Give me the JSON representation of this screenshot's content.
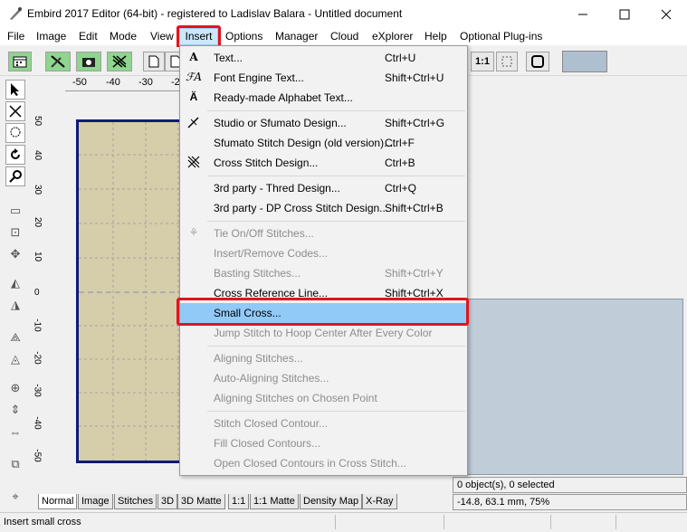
{
  "window": {
    "title": "Embird 2017 Editor (64-bit) - registered to Ladislav Balara - Untitled document",
    "minimize_icon": "minimize-icon",
    "maximize_icon": "maximize-icon",
    "close_icon": "close-icon"
  },
  "menubar": {
    "items": [
      "File",
      "Image",
      "Edit",
      "Mode",
      "View",
      "Insert",
      "Options",
      "Manager",
      "Cloud",
      "eXplorer",
      "Help",
      "Optional Plug-ins"
    ]
  },
  "ruler": {
    "h_ticks": [
      "-50",
      "-40",
      "-30",
      "-20"
    ],
    "v_ticks": [
      "50",
      "40",
      "30",
      "20",
      "10",
      "0",
      "-10",
      "-20",
      "-30",
      "-40",
      "-50"
    ]
  },
  "toolbar": {
    "btn_11": "1:1"
  },
  "insert_menu": {
    "items": [
      {
        "icon": "text-icon",
        "label": "Text...",
        "shortcut": "Ctrl+U",
        "enabled": true
      },
      {
        "icon": "font-engine-icon",
        "label": "Font Engine Text...",
        "shortcut": "Shift+Ctrl+U",
        "enabled": true
      },
      {
        "icon": "alphabet-icon",
        "label": "Ready-made Alphabet Text...",
        "shortcut": "",
        "enabled": true
      },
      {
        "icon": "studio-icon",
        "label": "Studio or Sfumato Design...",
        "shortcut": "Shift+Ctrl+G",
        "enabled": true
      },
      {
        "icon": "",
        "label": "Sfumato Stitch Design (old version)...",
        "shortcut": "Ctrl+F",
        "enabled": true
      },
      {
        "icon": "cross-stitch-icon",
        "label": "Cross Stitch Design...",
        "shortcut": "Ctrl+B",
        "enabled": true
      },
      {
        "icon": "",
        "label": "3rd party - Thred Design...",
        "shortcut": "Ctrl+Q",
        "enabled": true
      },
      {
        "icon": "",
        "label": "3rd party - DP Cross Stitch Design...",
        "shortcut": "Shift+Ctrl+B",
        "enabled": true
      },
      {
        "icon": "tie-icon",
        "label": "Tie On/Off Stitches...",
        "shortcut": "",
        "enabled": false
      },
      {
        "icon": "",
        "label": "Insert/Remove Codes...",
        "shortcut": "",
        "enabled": false
      },
      {
        "icon": "",
        "label": "Basting Stitches...",
        "shortcut": "Shift+Ctrl+Y",
        "enabled": false
      },
      {
        "icon": "",
        "label": "Cross Reference Line...",
        "shortcut": "Shift+Ctrl+X",
        "enabled": true
      },
      {
        "icon": "",
        "label": "Small Cross...",
        "shortcut": "",
        "enabled": true
      },
      {
        "icon": "",
        "label": "Jump Stitch to Hoop Center After Every Color",
        "shortcut": "",
        "enabled": false
      },
      {
        "icon": "",
        "label": "Aligning Stitches...",
        "shortcut": "",
        "enabled": false
      },
      {
        "icon": "",
        "label": "Auto-Aligning Stitches...",
        "shortcut": "",
        "enabled": false
      },
      {
        "icon": "",
        "label": "Aligning Stitches on Chosen Point",
        "shortcut": "",
        "enabled": false
      },
      {
        "icon": "",
        "label": "Stitch Closed Contour...",
        "shortcut": "",
        "enabled": false
      },
      {
        "icon": "",
        "label": "Fill Closed Contours...",
        "shortcut": "",
        "enabled": false
      },
      {
        "icon": "",
        "label": "Open Closed Contours in Cross Stitch...",
        "shortcut": "",
        "enabled": false
      }
    ]
  },
  "tabs": [
    "Normal",
    "Image",
    "Stitches",
    "3D",
    "3D Matte",
    "1:1",
    "1:1 Matte",
    "Density Map",
    "X-Ray"
  ],
  "info": {
    "objects": "0 object(s), 0 selected",
    "coords": "-14.8, 63.1 mm, 75%"
  },
  "status": {
    "text": "Insert small cross"
  },
  "colors": {
    "highlight": "#91c9f7",
    "annotation_red": "#e0151b",
    "design_fill": "#d6cdab",
    "design_border": "#101a7a",
    "color_panel": "#c0ccd8"
  }
}
